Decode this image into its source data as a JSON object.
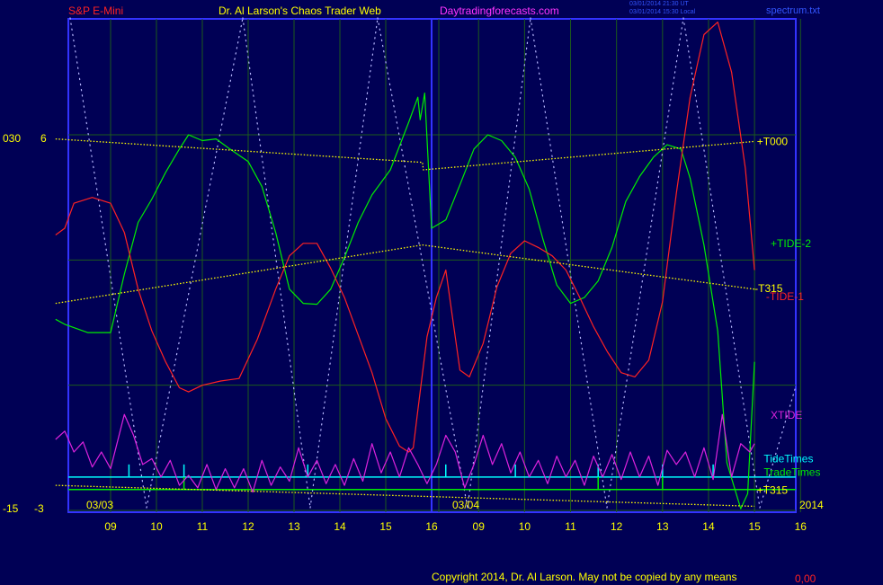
{
  "header": {
    "instrument": "S&P E-Mini",
    "author": "Dr. Al Larson's Chaos Trader Web",
    "site": "Daytradingforecasts.com",
    "stamp_line1": "03/01/2014 21:30 UT",
    "stamp_line2": "03/01/2014 15:30 Local",
    "file": "spectrum.txt"
  },
  "footer": {
    "copyright": "Copyright 2014, Dr. Al Larson. May not be copied by any means",
    "corner": "0,00"
  },
  "left_scale": {
    "top_a": "030",
    "top_b": "6",
    "bottom_a": "-15",
    "bottom_b": "-3"
  },
  "chart_data": {
    "type": "line",
    "x_unit": "hour",
    "x_ticks": [
      "09",
      "10",
      "11",
      "12",
      "13",
      "14",
      "15",
      "16",
      "09",
      "10",
      "11",
      "12",
      "13",
      "14",
      "15",
      "16"
    ],
    "date_labels": [
      {
        "text": "03/03",
        "at_x": 7.8
      },
      {
        "text": "03/04",
        "at_x": 15.8
      }
    ],
    "year_label": "2014",
    "x_range": [
      7.8,
      23.0
    ],
    "y_range": [
      -15,
      30
    ],
    "series": [
      {
        "name": "+TIDE-2",
        "color": "#00ee00",
        "points": [
          [
            7.8,
            7.9
          ],
          [
            8.0,
            7.3
          ],
          [
            8.5,
            6.3
          ],
          [
            9.0,
            6.3
          ],
          [
            9.3,
            13.3
          ],
          [
            9.6,
            19.5
          ],
          [
            9.9,
            22.3
          ],
          [
            10.2,
            25.5
          ],
          [
            10.5,
            28.3
          ],
          [
            10.7,
            30.0
          ],
          [
            11.0,
            29.3
          ],
          [
            11.3,
            29.5
          ],
          [
            11.6,
            28.3
          ],
          [
            12.0,
            26.8
          ],
          [
            12.3,
            23.8
          ],
          [
            12.6,
            18.3
          ],
          [
            12.9,
            11.5
          ],
          [
            13.2,
            9.8
          ],
          [
            13.5,
            9.7
          ],
          [
            13.8,
            11.5
          ],
          [
            14.1,
            15.3
          ],
          [
            14.4,
            19.5
          ],
          [
            14.7,
            22.8
          ],
          [
            15.1,
            25.8
          ],
          [
            15.5,
            31.5
          ],
          [
            15.7,
            34.5
          ],
          [
            15.75,
            31.8
          ],
          [
            15.85,
            35.0
          ],
          [
            16.0,
            18.8
          ],
          [
            16.3,
            19.8
          ],
          [
            16.6,
            24.0
          ],
          [
            16.9,
            28.3
          ],
          [
            17.2,
            30.0
          ],
          [
            17.5,
            29.3
          ],
          [
            17.8,
            27.3
          ],
          [
            18.1,
            23.5
          ],
          [
            18.4,
            17.5
          ],
          [
            18.7,
            12.0
          ],
          [
            19.0,
            9.8
          ],
          [
            19.3,
            10.5
          ],
          [
            19.6,
            12.5
          ],
          [
            19.9,
            16.5
          ],
          [
            20.2,
            22.0
          ],
          [
            20.5,
            25.0
          ],
          [
            20.8,
            27.3
          ],
          [
            21.1,
            28.8
          ],
          [
            21.4,
            28.3
          ],
          [
            21.6,
            24.8
          ],
          [
            21.9,
            16.8
          ],
          [
            22.2,
            6.5
          ],
          [
            22.4,
            -9.3
          ],
          [
            22.7,
            -14.8
          ],
          [
            22.85,
            -13.0
          ],
          [
            23.0,
            2.8
          ]
        ]
      },
      {
        "name": "-TIDE-1",
        "color": "#ff2222",
        "points": [
          [
            7.8,
            18.0
          ],
          [
            8.0,
            18.8
          ],
          [
            8.2,
            21.8
          ],
          [
            8.6,
            22.5
          ],
          [
            9.0,
            21.8
          ],
          [
            9.3,
            18.3
          ],
          [
            9.6,
            11.5
          ],
          [
            9.9,
            6.5
          ],
          [
            10.2,
            2.8
          ],
          [
            10.5,
            -0.3
          ],
          [
            10.7,
            -0.8
          ],
          [
            11.0,
            0.0
          ],
          [
            11.4,
            0.5
          ],
          [
            11.8,
            0.8
          ],
          [
            12.2,
            5.5
          ],
          [
            12.6,
            11.5
          ],
          [
            12.9,
            15.5
          ],
          [
            13.2,
            17.0
          ],
          [
            13.5,
            17.0
          ],
          [
            13.8,
            14.0
          ],
          [
            14.1,
            10.5
          ],
          [
            14.4,
            6.0
          ],
          [
            14.7,
            1.5
          ],
          [
            15.0,
            -4.0
          ],
          [
            15.3,
            -7.3
          ],
          [
            15.5,
            -8.0
          ],
          [
            15.6,
            -7.5
          ],
          [
            15.7,
            -3.0
          ],
          [
            15.9,
            5.8
          ],
          [
            16.1,
            10.5
          ],
          [
            16.3,
            13.8
          ],
          [
            16.6,
            1.8
          ],
          [
            16.8,
            1.0
          ],
          [
            17.1,
            5.0
          ],
          [
            17.4,
            11.8
          ],
          [
            17.7,
            15.8
          ],
          [
            18.0,
            17.3
          ],
          [
            18.3,
            16.5
          ],
          [
            18.6,
            15.5
          ],
          [
            18.9,
            13.8
          ],
          [
            19.2,
            10.5
          ],
          [
            19.5,
            7.0
          ],
          [
            19.8,
            4.0
          ],
          [
            20.1,
            1.5
          ],
          [
            20.4,
            1.0
          ],
          [
            20.7,
            3.0
          ],
          [
            21.0,
            10.0
          ],
          [
            21.3,
            23.0
          ],
          [
            21.6,
            34.5
          ],
          [
            21.9,
            42.0
          ],
          [
            22.2,
            43.5
          ],
          [
            22.5,
            37.5
          ],
          [
            22.8,
            26.0
          ],
          [
            23.0,
            13.8
          ]
        ]
      },
      {
        "name": "XTIDE",
        "color": "#dd22dd",
        "points": [
          [
            7.8,
            -6.5
          ],
          [
            8.0,
            -5.5
          ],
          [
            8.2,
            -8.0
          ],
          [
            8.4,
            -6.8
          ],
          [
            8.6,
            -9.8
          ],
          [
            8.8,
            -8.0
          ],
          [
            9.0,
            -10.0
          ],
          [
            9.3,
            -3.5
          ],
          [
            9.5,
            -6.0
          ],
          [
            9.7,
            -9.5
          ],
          [
            9.9,
            -8.8
          ],
          [
            10.1,
            -11.0
          ],
          [
            10.3,
            -9.0
          ],
          [
            10.5,
            -12.0
          ],
          [
            10.7,
            -10.8
          ],
          [
            10.9,
            -12.3
          ],
          [
            11.1,
            -9.5
          ],
          [
            11.3,
            -12.5
          ],
          [
            11.5,
            -10.0
          ],
          [
            11.7,
            -12.3
          ],
          [
            11.9,
            -10.0
          ],
          [
            12.1,
            -12.8
          ],
          [
            12.3,
            -9.0
          ],
          [
            12.5,
            -12.0
          ],
          [
            12.7,
            -9.8
          ],
          [
            12.9,
            -11.5
          ],
          [
            13.1,
            -7.5
          ],
          [
            13.3,
            -11.0
          ],
          [
            13.5,
            -9.0
          ],
          [
            13.7,
            -11.8
          ],
          [
            13.9,
            -9.5
          ],
          [
            14.1,
            -12.0
          ],
          [
            14.3,
            -8.8
          ],
          [
            14.5,
            -11.5
          ],
          [
            14.7,
            -7.0
          ],
          [
            14.9,
            -10.5
          ],
          [
            15.1,
            -8.0
          ],
          [
            15.3,
            -11.0
          ],
          [
            15.5,
            -7.5
          ],
          [
            15.7,
            -9.5
          ],
          [
            15.9,
            -11.8
          ],
          [
            16.1,
            -9.5
          ],
          [
            16.3,
            -6.0
          ],
          [
            16.5,
            -8.0
          ],
          [
            16.7,
            -12.3
          ],
          [
            16.9,
            -9.5
          ],
          [
            17.1,
            -6.0
          ],
          [
            17.3,
            -9.5
          ],
          [
            17.5,
            -7.0
          ],
          [
            17.7,
            -10.5
          ],
          [
            17.9,
            -8.0
          ],
          [
            18.1,
            -11.0
          ],
          [
            18.3,
            -9.0
          ],
          [
            18.5,
            -11.8
          ],
          [
            18.7,
            -8.5
          ],
          [
            18.9,
            -11.0
          ],
          [
            19.1,
            -9.0
          ],
          [
            19.3,
            -12.0
          ],
          [
            19.5,
            -8.5
          ],
          [
            19.7,
            -11.0
          ],
          [
            19.9,
            -8.3
          ],
          [
            20.1,
            -11.3
          ],
          [
            20.3,
            -8.0
          ],
          [
            20.5,
            -11.0
          ],
          [
            20.7,
            -8.5
          ],
          [
            20.9,
            -12.0
          ],
          [
            21.1,
            -7.8
          ],
          [
            21.3,
            -9.5
          ],
          [
            21.5,
            -8.0
          ],
          [
            21.7,
            -11.0
          ],
          [
            21.9,
            -7.5
          ],
          [
            22.1,
            -11.3
          ],
          [
            22.3,
            -3.5
          ],
          [
            22.5,
            -11.0
          ],
          [
            22.7,
            -7.0
          ],
          [
            22.9,
            -8.0
          ],
          [
            23.0,
            -7.0
          ]
        ]
      },
      {
        "name": "+T000",
        "color": "#ffff00",
        "dotted": true,
        "points": [
          [
            7.8,
            29.5
          ],
          [
            15.8,
            26.7
          ],
          [
            15.82,
            25.8
          ],
          [
            23.0,
            29.2
          ]
        ]
      },
      {
        "name": "-T315",
        "color": "#ffff00",
        "dotted": true,
        "points": [
          [
            7.8,
            9.8
          ],
          [
            15.8,
            16.8
          ],
          [
            23.0,
            11.5
          ]
        ]
      },
      {
        "name": "+T315",
        "color": "#ffff00",
        "dotted": true,
        "points": [
          [
            7.8,
            -12.0
          ],
          [
            23.0,
            -14.5
          ]
        ]
      }
    ],
    "mark_rows": [
      {
        "name": "TideTimes",
        "color": "#00ffff",
        "level": -11.0,
        "marks_at": [
          9.4,
          10.6,
          13.3,
          16.3,
          17.8,
          19.6,
          21.0,
          22.1
        ]
      },
      {
        "name": "TradeTimes",
        "color": "#00ee00",
        "level": -12.5,
        "marks_at": [
          10.6,
          19.6,
          21.0
        ]
      }
    ],
    "line_labels": [
      {
        "text": "+T000",
        "color": "#ffff00",
        "at": [
          23.05,
          29.2
        ]
      },
      {
        "text": "+TIDE-2",
        "color": "#00ee00",
        "at": [
          23.35,
          17.0
        ]
      },
      {
        "text": "-T315",
        "color": "#ffff00",
        "at": [
          23.0,
          11.6
        ]
      },
      {
        "text": "-TIDE-1",
        "color": "#ff2222",
        "at": [
          23.25,
          10.6
        ]
      },
      {
        "text": "XTIDE",
        "color": "#dd22dd",
        "at": [
          23.35,
          -3.6
        ]
      },
      {
        "text": "TideTimes",
        "color": "#00ffff",
        "at": [
          23.2,
          -8.8
        ]
      },
      {
        "text": "TradeTimes",
        "color": "#00ee00",
        "at": [
          23.2,
          -10.4
        ]
      },
      {
        "text": "+T315",
        "color": "#ffff00",
        "at": [
          23.05,
          -12.6
        ]
      }
    ]
  }
}
